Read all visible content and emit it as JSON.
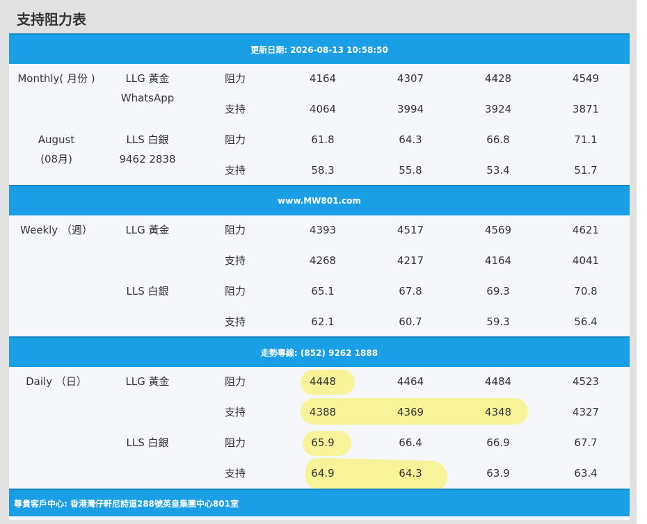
{
  "page_title": "支持阻力表",
  "banners": {
    "update": "更新日期: 2026-08-13 10:58:50",
    "website": "www.MW801.com",
    "hotline": "走勢專線: (852) 9262 1888",
    "address": "尊貴客戶中心: 香港灣仔軒尼詩道288號英皇集團中心801室"
  },
  "monthly": {
    "period_line1": "Monthly( 月份 )",
    "period_line2": "August",
    "period_line3": "(08月)",
    "llg_label": "LLG 黃金",
    "llg_sub": "WhatsApp",
    "lls_label": "LLS 白銀",
    "lls_sub": "9462 2838",
    "resist_label": "阻力",
    "support_label": "支持",
    "llg_resist": [
      "4164",
      "4307",
      "4428",
      "4549"
    ],
    "llg_support": [
      "4064",
      "3994",
      "3924",
      "3871"
    ],
    "lls_resist": [
      "61.8",
      "64.3",
      "66.8",
      "71.1"
    ],
    "lls_support": [
      "58.3",
      "55.8",
      "53.4",
      "51.7"
    ]
  },
  "weekly": {
    "period": "Weekly （週）",
    "llg_label": "LLG 黃金",
    "lls_label": "LLS 白銀",
    "resist_label": "阻力",
    "support_label": "支持",
    "llg_resist": [
      "4393",
      "4517",
      "4569",
      "4621"
    ],
    "llg_support": [
      "4268",
      "4217",
      "4164",
      "4041"
    ],
    "lls_resist": [
      "65.1",
      "67.8",
      "69.3",
      "70.8"
    ],
    "lls_support": [
      "62.1",
      "60.7",
      "59.3",
      "56.4"
    ]
  },
  "daily": {
    "period": "Daily （日）",
    "llg_label": "LLG 黃金",
    "lls_label": "LLS 白銀",
    "resist_label": "阻力",
    "support_label": "支持",
    "llg_resist": [
      "4448",
      "4464",
      "4484",
      "4523"
    ],
    "llg_support": [
      "4388",
      "4369",
      "4348",
      "4327"
    ],
    "lls_resist": [
      "65.9",
      "66.4",
      "66.9",
      "67.7"
    ],
    "lls_support": [
      "64.9",
      "64.3",
      "63.9",
      "63.4"
    ]
  },
  "colors": {
    "banner_blue": "#1a9fe6",
    "highlight_yellow": "#f6f278",
    "table_bg": "#f5f7fb"
  }
}
